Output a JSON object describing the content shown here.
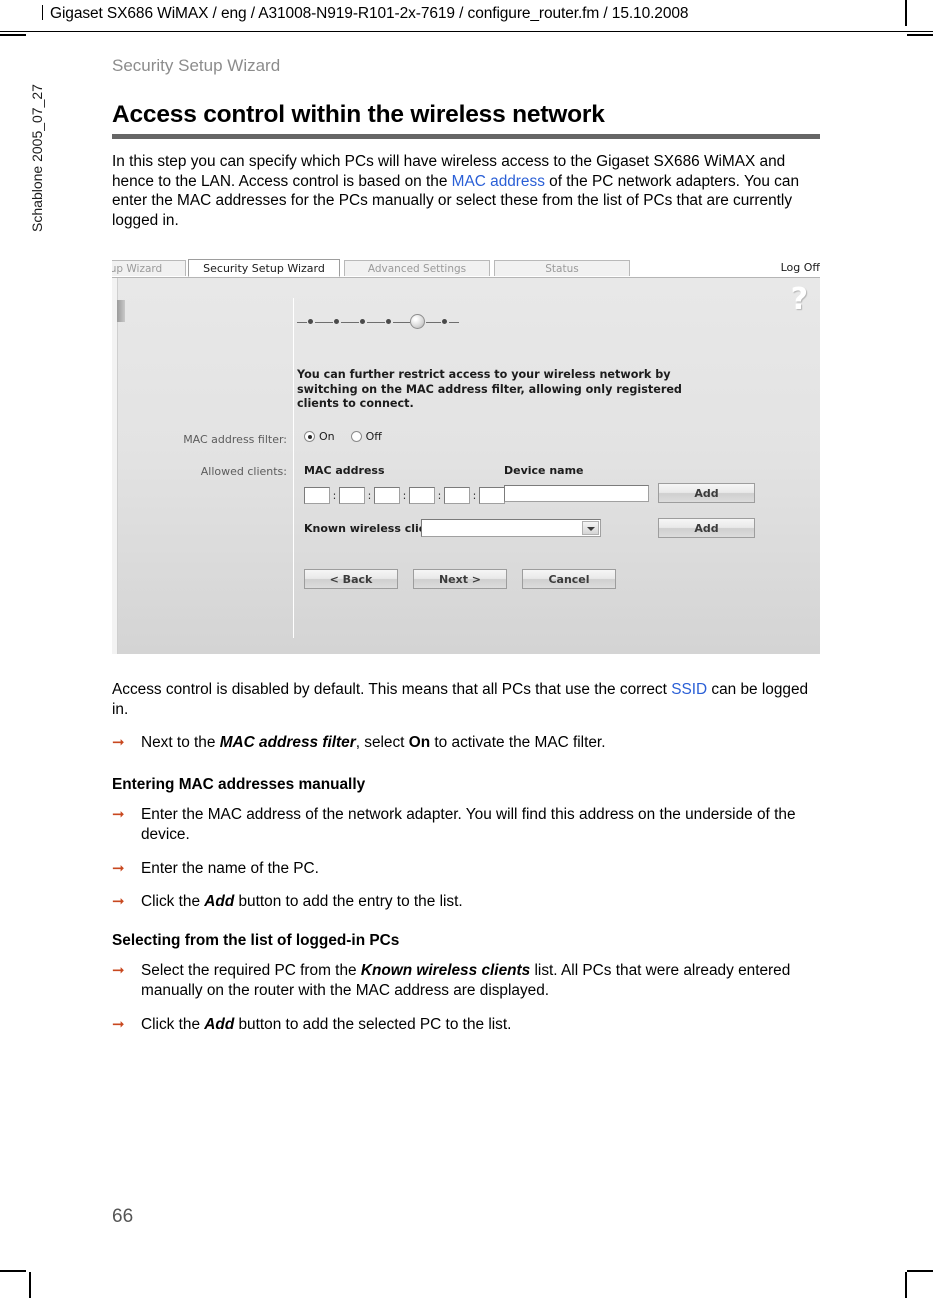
{
  "header": {
    "running_head": "Gigaset SX686 WiMAX / eng / A31008-N919-R101-2x-7619 / configure_router.fm / 15.10.2008",
    "spine": "Schablone 2005_07_27"
  },
  "page": {
    "chapter": "Security Setup Wizard",
    "title": "Access control within the wireless network",
    "number": "66"
  },
  "intro": {
    "part1": "In this step you can specify which PCs will have wireless access to the Gigaset SX686 WiMAX and hence to the LAN. Access control is based on the ",
    "link": "MAC address",
    "part2": " of the PC network adapters. You can enter the MAC addresses for the PCs manually or select these from the list of PCs that are currently logged in."
  },
  "screenshot": {
    "tabs": [
      {
        "label": "up Wizard",
        "state": "cut"
      },
      {
        "label": "Security Setup Wizard",
        "state": "active"
      },
      {
        "label": "Advanced Settings",
        "state": "normal"
      },
      {
        "label": "Status",
        "state": "normal"
      }
    ],
    "logoff": "Log Off",
    "help_icon": "?",
    "steps": {
      "total": 6,
      "current": 5
    },
    "info_text_lines": [
      "You can further restrict access to your wireless network by",
      "switching on the MAC address filter, allowing only registered",
      "clients to connect."
    ],
    "mac_filter_label": "MAC address filter:",
    "radio_on": "On",
    "radio_off": "Off",
    "radio_selected": "On",
    "allowed_clients_label": "Allowed clients:",
    "col_mac_address": "MAC address",
    "col_device_name": "Device name",
    "mac_octets": [
      "",
      "",
      "",
      "",
      "",
      ""
    ],
    "octet_separator": ":",
    "device_name_value": "",
    "add_button_1": "Add",
    "known_clients_label": "Known wireless clients:",
    "known_clients_value": "",
    "add_button_2": "Add",
    "nav_back": "< Back",
    "nav_next": "Next >",
    "nav_cancel": "Cancel"
  },
  "after": {
    "p1_part1": "Access control is disabled by default. This means that all PCs that use the correct ",
    "p1_link": "SSID",
    "p1_part2": " can be logged in.",
    "bullet1": {
      "pre": "Next to the ",
      "bi": "MAC address filter",
      "mid": ", select ",
      "b": "On",
      "post": " to activate the MAC filter."
    },
    "section1_title": "Entering MAC addresses manually",
    "bullet2": "Enter the MAC address of the network adapter. You will find this address on the underside of the device.",
    "bullet3": "Enter the name of the PC.",
    "bullet4": {
      "pre": "Click the ",
      "bi": "Add",
      "post": " button to add the entry to the list."
    },
    "section2_title": "Selecting from the list of logged-in PCs",
    "bullet5": {
      "pre": "Select the required PC from the ",
      "bi": "Known wireless clients",
      "post": " list. All PCs that were already entered manually on the router with the MAC address are displayed."
    },
    "bullet6": {
      "pre": "Click the ",
      "bi": "Add",
      "post": " button to add the selected PC to the list."
    }
  },
  "colors": {
    "link": "#2a5fd6",
    "rule": "#666666",
    "chapter": "#8c8c8c",
    "arrow": "#c8481f"
  }
}
